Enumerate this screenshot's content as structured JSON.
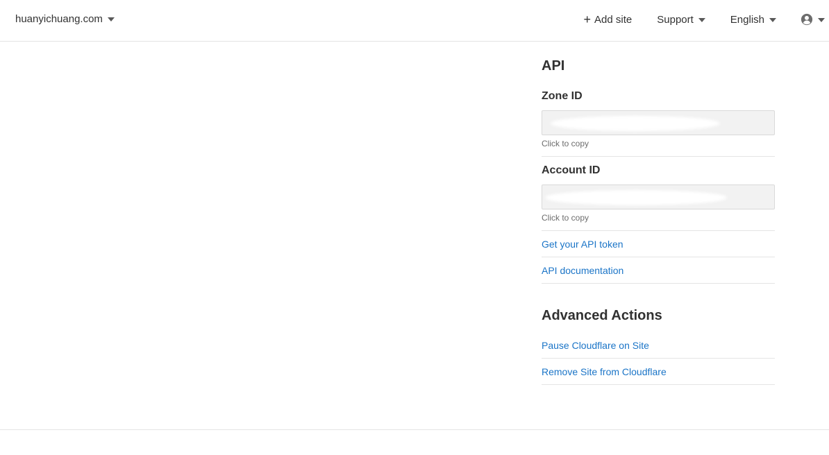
{
  "header": {
    "site_name": "huanyichuang.com",
    "add_site_label": "Add site",
    "support_label": "Support",
    "language_label": "English"
  },
  "api": {
    "title": "API",
    "zone_id_label": "Zone ID",
    "zone_id_hint": "Click to copy",
    "account_id_label": "Account ID",
    "account_id_hint": "Click to copy",
    "get_token_link": "Get your API token",
    "docs_link": "API documentation"
  },
  "advanced": {
    "title": "Advanced Actions",
    "pause_link": "Pause Cloudflare on Site",
    "remove_link": "Remove Site from Cloudflare"
  },
  "colors": {
    "link": "#1a74c7",
    "text": "#313131",
    "border": "#e4e4e4"
  }
}
